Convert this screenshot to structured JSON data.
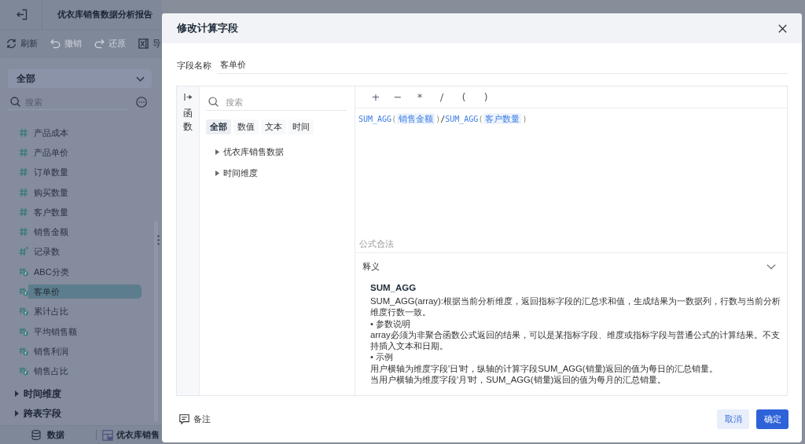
{
  "app": {
    "title": "优衣库销售数据分析报告",
    "toolbar": [
      {
        "kind": "refresh",
        "label": "刷新",
        "disabled": false
      },
      {
        "kind": "undo",
        "label": "撤销",
        "disabled": true
      },
      {
        "kind": "redo",
        "label": "还原",
        "disabled": true
      },
      {
        "kind": "export",
        "label": "导",
        "disabled": false
      }
    ]
  },
  "sidebar": {
    "filter": "全部",
    "search": {
      "placeholder": "搜索"
    },
    "fields": [
      {
        "kind": "measure",
        "label": "产品成本",
        "selected": false
      },
      {
        "kind": "measure",
        "label": "产品单价",
        "selected": false
      },
      {
        "kind": "measure",
        "label": "订单数量",
        "selected": false
      },
      {
        "kind": "measure",
        "label": "购买数量",
        "selected": false
      },
      {
        "kind": "measure",
        "label": "客户数量",
        "selected": false
      },
      {
        "kind": "measure",
        "label": "销售金额",
        "selected": false
      },
      {
        "kind": "count",
        "label": "记录数",
        "selected": false
      },
      {
        "kind": "calculated",
        "label": "ABC分类",
        "selected": false
      },
      {
        "kind": "calculated",
        "label": "客单价",
        "selected": true
      },
      {
        "kind": "calculated",
        "label": "累计占比",
        "selected": false
      },
      {
        "kind": "calculated",
        "label": "平均销售额",
        "selected": false
      },
      {
        "kind": "calculated",
        "label": "销售利润",
        "selected": false
      },
      {
        "kind": "calculated",
        "label": "销售占比",
        "selected": false
      }
    ],
    "groups": [
      {
        "label": "时间维度",
        "expanded": false
      },
      {
        "label": "跨表字段",
        "expanded": false
      }
    ],
    "bottom_tabs": [
      {
        "kind": "data",
        "label": "数据"
      },
      {
        "kind": "sheet",
        "label": "优衣库销售"
      }
    ]
  },
  "dialog": {
    "title": "修改计算字段",
    "field_name": {
      "label": "字段名称",
      "value": "客单价"
    },
    "function_panel": {
      "label": "函数",
      "search": {
        "placeholder": "搜索"
      },
      "categories": [
        {
          "label": "全部",
          "selected": true
        },
        {
          "label": "数值",
          "selected": false
        },
        {
          "label": "文本",
          "selected": false
        },
        {
          "label": "时间",
          "selected": false
        }
      ],
      "tree": [
        {
          "label": "优衣库销售数据",
          "expanded": false
        },
        {
          "label": "时间维度",
          "expanded": false
        }
      ]
    },
    "operators": [
      "+",
      "−",
      "*",
      "/",
      "(",
      ")"
    ],
    "formula": [
      {
        "kind": "function",
        "text": "SUM_AGG"
      },
      {
        "kind": "paren",
        "text": "("
      },
      {
        "kind": "field",
        "text": "销售金额"
      },
      {
        "kind": "paren",
        "text": ")"
      },
      {
        "kind": "operator",
        "text": "/"
      },
      {
        "kind": "function",
        "text": "SUM_AGG"
      },
      {
        "kind": "paren",
        "text": "("
      },
      {
        "kind": "field",
        "text": "客户数量"
      },
      {
        "kind": "paren",
        "text": ")"
      }
    ],
    "validation": "公式合法",
    "description": {
      "title": "释义",
      "expanded": true,
      "function_name": "SUM_AGG",
      "paragraphs": [
        "SUM_AGG(array):根据当前分析维度，返回指标字段的汇总求和值，生成结果为一数据列，行数与当前分析维度行数一致。",
        "•  参数说明",
        "array必须为非聚合函数公式返回的结果，可以是某指标字段、维度或指标字段与普通公式的计算结果。不支持插入文本和日期。",
        "•  示例",
        "用户横轴为维度字段'日'时，纵轴的计算字段SUM_AGG(销量)返回的值为每日的汇总销量。",
        "当用户横轴为维度字段'月'时，SUM_AGG(销量)返回的值为每月的汇总销量。"
      ]
    },
    "note": "备注",
    "buttons": [
      {
        "kind": "cancel",
        "label": "取消"
      },
      {
        "kind": "confirm",
        "label": "确定"
      }
    ]
  }
}
